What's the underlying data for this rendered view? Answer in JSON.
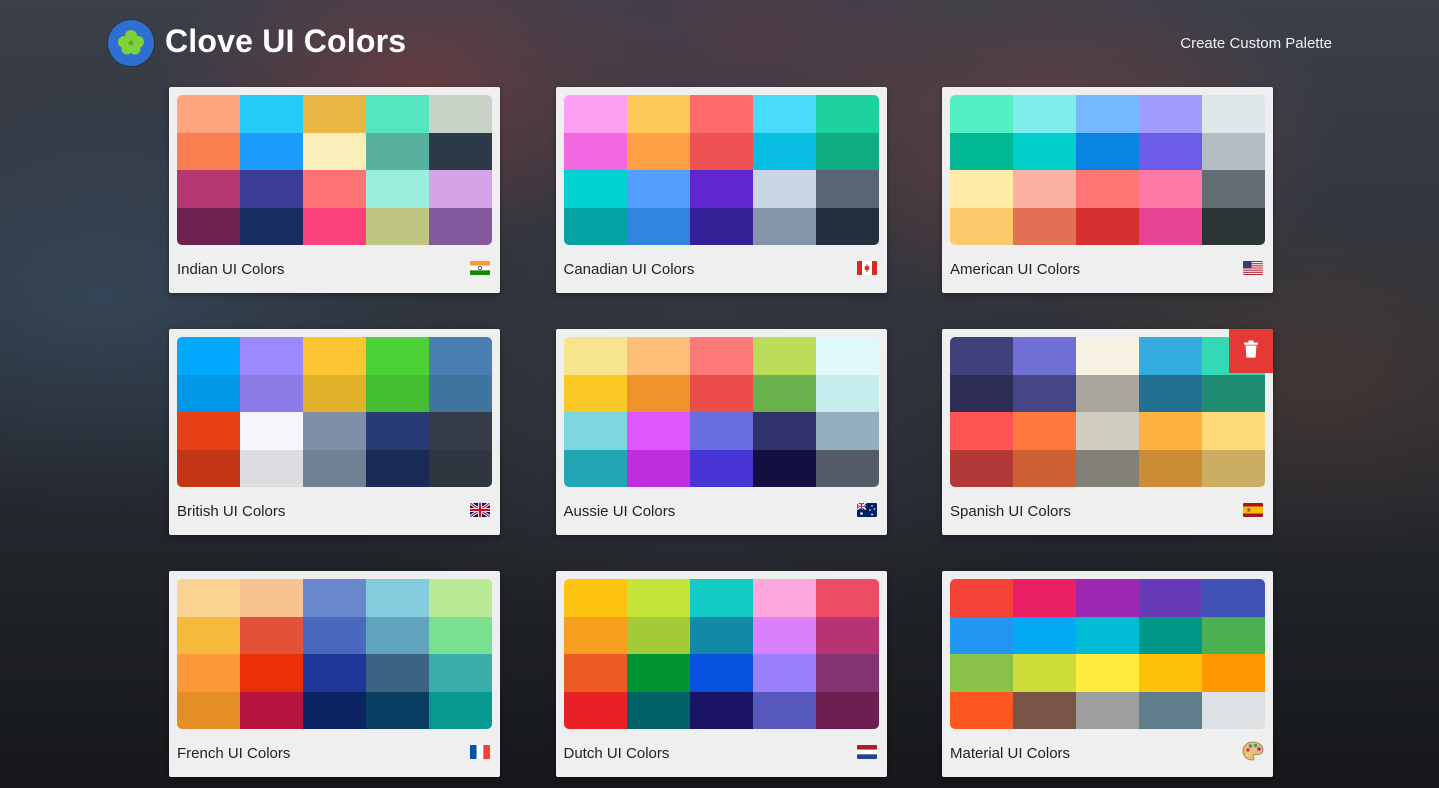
{
  "app": {
    "title": "Clove UI Colors",
    "create_link": "Create Custom Palette",
    "logo_icon": "clover-icon"
  },
  "palettes": [
    {
      "name": "Indian UI Colors",
      "flag": "india-flag-icon",
      "colors": [
        [
          "#FEA47F",
          "#25CCF7",
          "#EAB543",
          "#55E6C1",
          "#CAD3C8"
        ],
        [
          "#F97F51",
          "#1B9CFC",
          "#F8EFBA",
          "#58B19F",
          "#2C3A47"
        ],
        [
          "#B33771",
          "#3B3B98",
          "#FD7272",
          "#9AECDB",
          "#D6A2E8"
        ],
        [
          "#6D214F",
          "#182C61",
          "#FC427B",
          "#BDC581",
          "#82589F"
        ]
      ]
    },
    {
      "name": "Canadian UI Colors",
      "flag": "canada-flag-icon",
      "colors": [
        [
          "#FF9FF3",
          "#FECA57",
          "#FF6B6B",
          "#48DBFB",
          "#1DD1A1"
        ],
        [
          "#F368E0",
          "#FF9F43",
          "#EE5253",
          "#0ABDE3",
          "#10AC84"
        ],
        [
          "#00D2D3",
          "#54A0FF",
          "#5F27CD",
          "#C8D6E5",
          "#576574"
        ],
        [
          "#01A3A4",
          "#2E86DE",
          "#341F97",
          "#8395A7",
          "#222F3E"
        ]
      ]
    },
    {
      "name": "American UI Colors",
      "flag": "usa-flag-icon",
      "colors": [
        [
          "#55EFC4",
          "#81ECEC",
          "#74B9FF",
          "#A29BFE",
          "#DFE6E9"
        ],
        [
          "#00B894",
          "#00CEC9",
          "#0984E3",
          "#6C5CE7",
          "#B2BEC3"
        ],
        [
          "#FFEAA7",
          "#FAB1A0",
          "#FF7675",
          "#FD79A8",
          "#636E72"
        ],
        [
          "#FDCB6E",
          "#E17055",
          "#D63031",
          "#E84393",
          "#2D3436"
        ]
      ]
    },
    {
      "name": "British UI Colors",
      "flag": "uk-flag-icon",
      "colors": [
        [
          "#00A8FF",
          "#9C88FF",
          "#FBC531",
          "#4CD137",
          "#487EB0"
        ],
        [
          "#0097E6",
          "#8C7AE6",
          "#E1B12C",
          "#44BD32",
          "#40739E"
        ],
        [
          "#E84118",
          "#F5F6FA",
          "#7F8FA6",
          "#273C75",
          "#353B48"
        ],
        [
          "#C23616",
          "#DCDDE1",
          "#718093",
          "#192A56",
          "#2F3640"
        ]
      ]
    },
    {
      "name": "Aussie UI Colors",
      "flag": "australia-flag-icon",
      "colors": [
        [
          "#F6E58D",
          "#FFBE76",
          "#FF7979",
          "#BADC58",
          "#DFF9FB"
        ],
        [
          "#F9CA24",
          "#F0932B",
          "#EB4D4B",
          "#6AB04C",
          "#C7ECEE"
        ],
        [
          "#7ED6DF",
          "#E056FD",
          "#686DE0",
          "#30336B",
          "#95AFC0"
        ],
        [
          "#22A6B3",
          "#BE2EDD",
          "#4834D4",
          "#130F40",
          "#535C68"
        ]
      ]
    },
    {
      "name": "Spanish UI Colors",
      "flag": "spain-flag-icon",
      "colors": [
        [
          "#40407A",
          "#706FD3",
          "#F7F1E3",
          "#34ACE0",
          "#33D9B2"
        ],
        [
          "#2C2C54",
          "#474787",
          "#AAA69D",
          "#227093",
          "#218C74"
        ],
        [
          "#FF5252",
          "#FF793F",
          "#D1CCC0",
          "#FFB142",
          "#FFDA79"
        ],
        [
          "#B33939",
          "#CD6133",
          "#84817A",
          "#CC8E35",
          "#CCAE62"
        ]
      ]
    },
    {
      "name": "French UI Colors",
      "flag": "france-flag-icon",
      "colors": [
        [
          "#FAD390",
          "#F8C291",
          "#6A89CC",
          "#82CCDD",
          "#B8E994"
        ],
        [
          "#F6B93B",
          "#E55039",
          "#4A69BD",
          "#60A3BC",
          "#78E08F"
        ],
        [
          "#FA983A",
          "#EB2F06",
          "#1E3799",
          "#3C6382",
          "#38ADA9"
        ],
        [
          "#E58E26",
          "#B71540",
          "#0C2461",
          "#0A3D62",
          "#079992"
        ]
      ]
    },
    {
      "name": "Dutch UI Colors",
      "flag": "netherlands-flag-icon",
      "colors": [
        [
          "#FFC312",
          "#C4E538",
          "#12CBC4",
          "#FDA7DF",
          "#ED4C67"
        ],
        [
          "#F79F1F",
          "#A3CB38",
          "#1289A7",
          "#D980FA",
          "#B53471"
        ],
        [
          "#EE5A24",
          "#009432",
          "#0652DD",
          "#9980FA",
          "#833471"
        ],
        [
          "#EA2027",
          "#006266",
          "#1B1464",
          "#5758BB",
          "#6F1E51"
        ]
      ]
    },
    {
      "name": "Material UI Colors",
      "flag": "palette-icon",
      "colors": [
        [
          "#F44336",
          "#E91E63",
          "#9C27B0",
          "#673AB7",
          "#3F51B5"
        ],
        [
          "#2196F3",
          "#03A9F4",
          "#00BCD4",
          "#009688",
          "#4CAF50"
        ],
        [
          "#8BC34A",
          "#CDDC39",
          "#FFEB3B",
          "#FFC107",
          "#FF9800"
        ],
        [
          "#FF5722",
          "#795548",
          "#9E9E9E",
          "#607D8B",
          "#DEE1E4"
        ]
      ]
    }
  ],
  "delete_button": {
    "icon": "trash-icon",
    "card_index": 5,
    "color": "#E53935"
  }
}
